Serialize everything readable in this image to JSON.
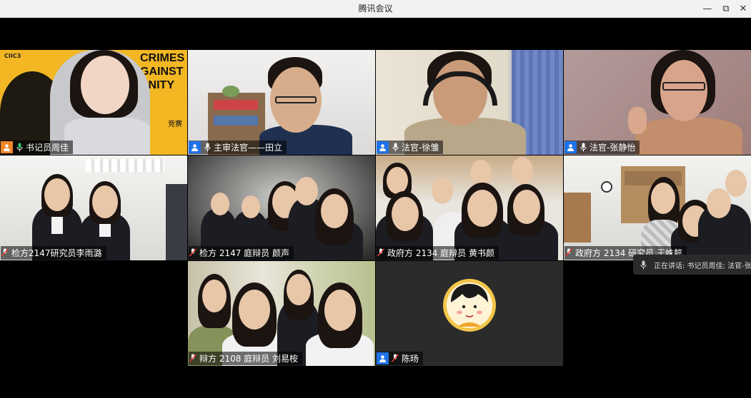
{
  "window": {
    "title": "腾讯会议",
    "minimize": "—",
    "maximize": "⧉",
    "close": "✕"
  },
  "tiles": [
    {
      "name": "书记员周佳",
      "badge": "orange",
      "active": true,
      "poster": {
        "line1": "CRIMES",
        "line2": "GAINST",
        "line3": "ANITY",
        "line4": "竞赛"
      },
      "logo1": "CIIC3"
    },
    {
      "name": "主审法官——田立",
      "badge": "blue"
    },
    {
      "name": "法官-徐雏",
      "badge": "blue"
    },
    {
      "name": "法官-张静怡",
      "badge": "blue"
    },
    {
      "name": "检方2147研究员李雨潞",
      "badge": "none"
    },
    {
      "name": "检方 2147 庭辩员 颜声",
      "badge": "none"
    },
    {
      "name": "政府方 2134 庭辩员 黄书颜",
      "badge": "none"
    },
    {
      "name": "政府方 2134 研究员 王姝懿",
      "badge": "none"
    },
    {
      "name": "辩方 2108 庭辩员 刘易桉",
      "badge": "none"
    },
    {
      "name": "陈旸",
      "badge": "blue"
    }
  ],
  "toast": {
    "text": "正在讲话: 书记员周佳; 法官-张"
  },
  "colors": {
    "accent_blue": "#1e72e8",
    "active_green": "#2fc468",
    "badge_orange": "#f0862a"
  }
}
